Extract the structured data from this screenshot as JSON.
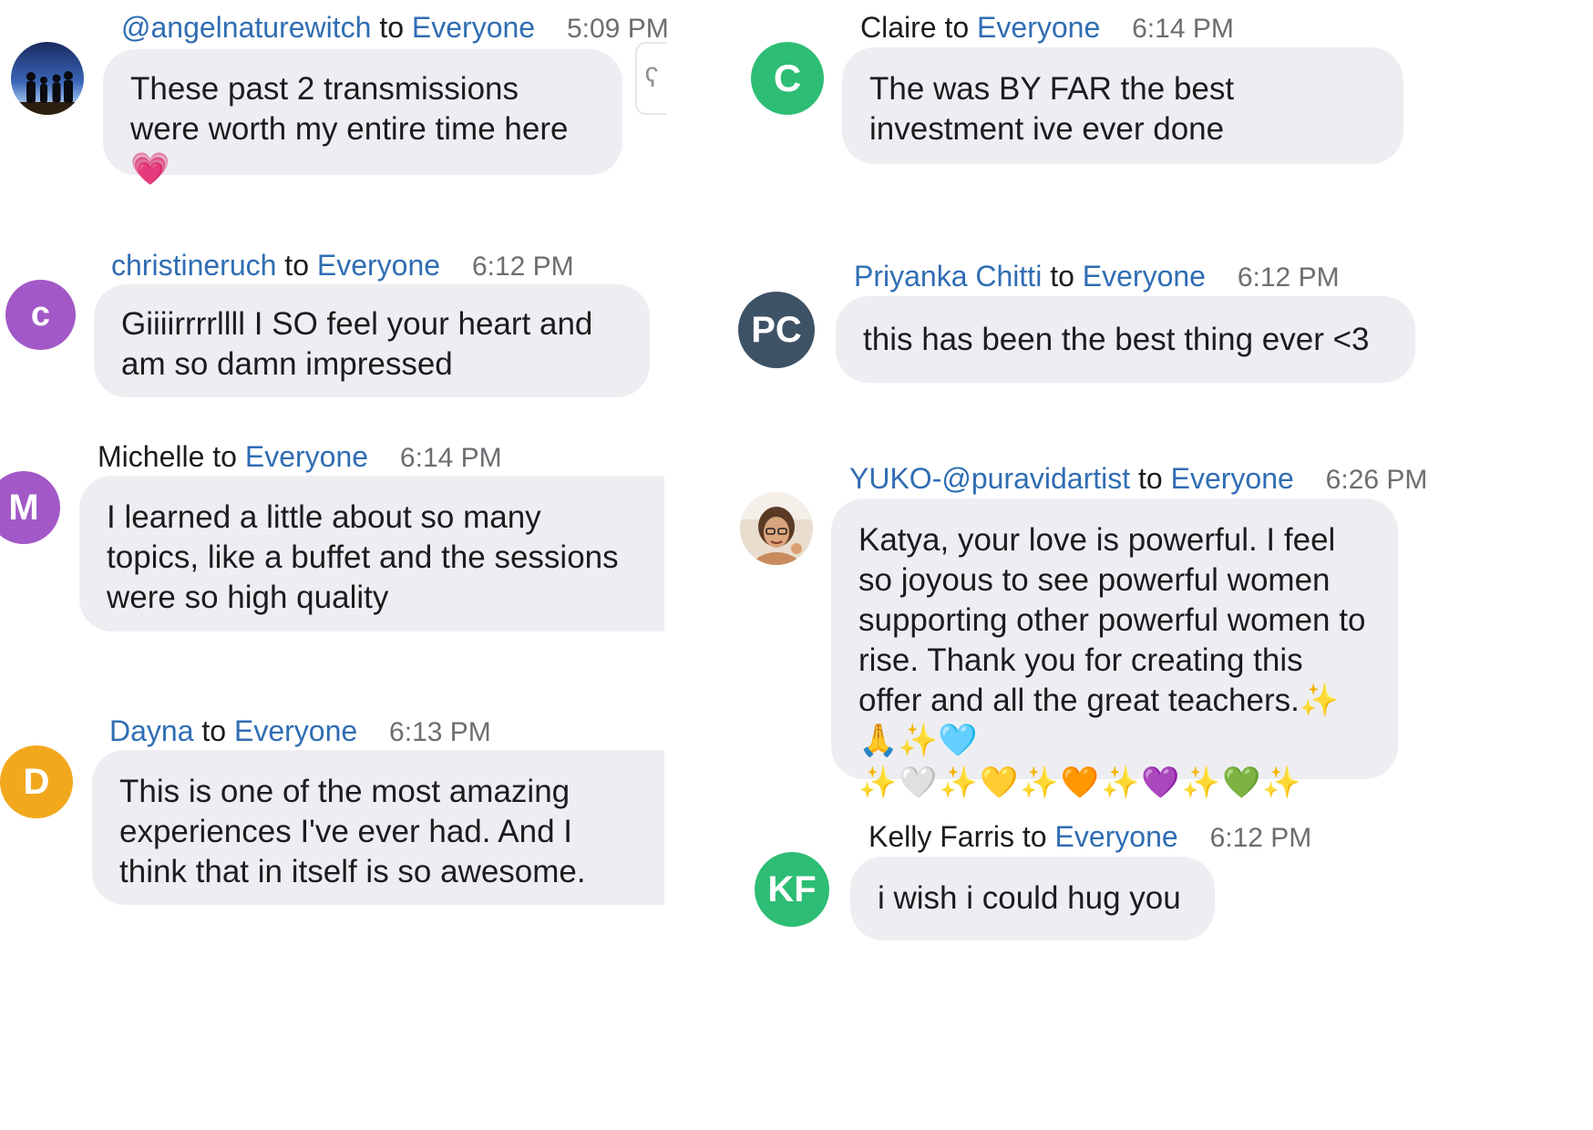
{
  "messages": [
    {
      "sender": "@angelnaturewitch",
      "to_word": "to",
      "recipient": "Everyone",
      "time": "5:09 PM",
      "text": "These past 2 transmissions were worth my entire time here 💗",
      "avatar": {
        "type": "photo",
        "icon": "family-silhouette-photo"
      }
    },
    {
      "sender": "christineruch",
      "to_word": "to",
      "recipient": "Everyone",
      "time": "6:12 PM",
      "text": "Giiiirrrrllll I SO feel your heart and am so damn impressed",
      "avatar": {
        "type": "initials",
        "initials": "c",
        "color": "#a259c7"
      }
    },
    {
      "sender": "Michelle",
      "to_word": "to",
      "recipient": "Everyone",
      "time": "6:14 PM",
      "text": "I learned a little about so many topics, like a buffet and the sessions were so high quality",
      "avatar": {
        "type": "initials",
        "initials": "M",
        "color": "#a259c7"
      }
    },
    {
      "sender": "Dayna",
      "to_word": "to",
      "recipient": "Everyone",
      "time": "6:13 PM",
      "text": "This is one of the most amazing experiences I've ever had. And I think that in itself is so awesome.",
      "avatar": {
        "type": "initials",
        "initials": "D",
        "color": "#f2a81d"
      }
    },
    {
      "sender": "Claire",
      "to_word": "to",
      "recipient": "Everyone",
      "time": "6:14 PM",
      "text": "The was BY FAR the best investment ive ever done",
      "avatar": {
        "type": "initials",
        "initials": "C",
        "color": "#2dbd75"
      }
    },
    {
      "sender": "Priyanka Chitti",
      "to_word": "to",
      "recipient": "Everyone",
      "time": "6:12 PM",
      "text": "this has been the best thing ever <3",
      "avatar": {
        "type": "initials",
        "initials": "PC",
        "color": "#3e5266"
      }
    },
    {
      "sender": "YUKO-@puravidartist",
      "to_word": "to",
      "recipient": "Everyone",
      "time": "6:26 PM",
      "text": "Katya, your love is powerful. I feel so joyous to see powerful women supporting other powerful women to rise. Thank you for creating this offer and all the great teachers.✨🙏✨🩵",
      "text_emoji_line": "✨🤍✨💛✨🧡✨💜✨💚✨",
      "avatar": {
        "type": "photo",
        "icon": "woman-portrait-photo"
      }
    },
    {
      "sender": "Kelly Farris",
      "to_word": "to",
      "recipient": "Everyone",
      "time": "6:12 PM",
      "text": "i wish i could hug you",
      "avatar": {
        "type": "initials",
        "initials": "KF",
        "color": "#2dbd75"
      }
    }
  ],
  "colors": {
    "link_blue": "#2f6db3",
    "bubble_bg": "#eeeef2",
    "time_gray": "#6d6d72"
  }
}
